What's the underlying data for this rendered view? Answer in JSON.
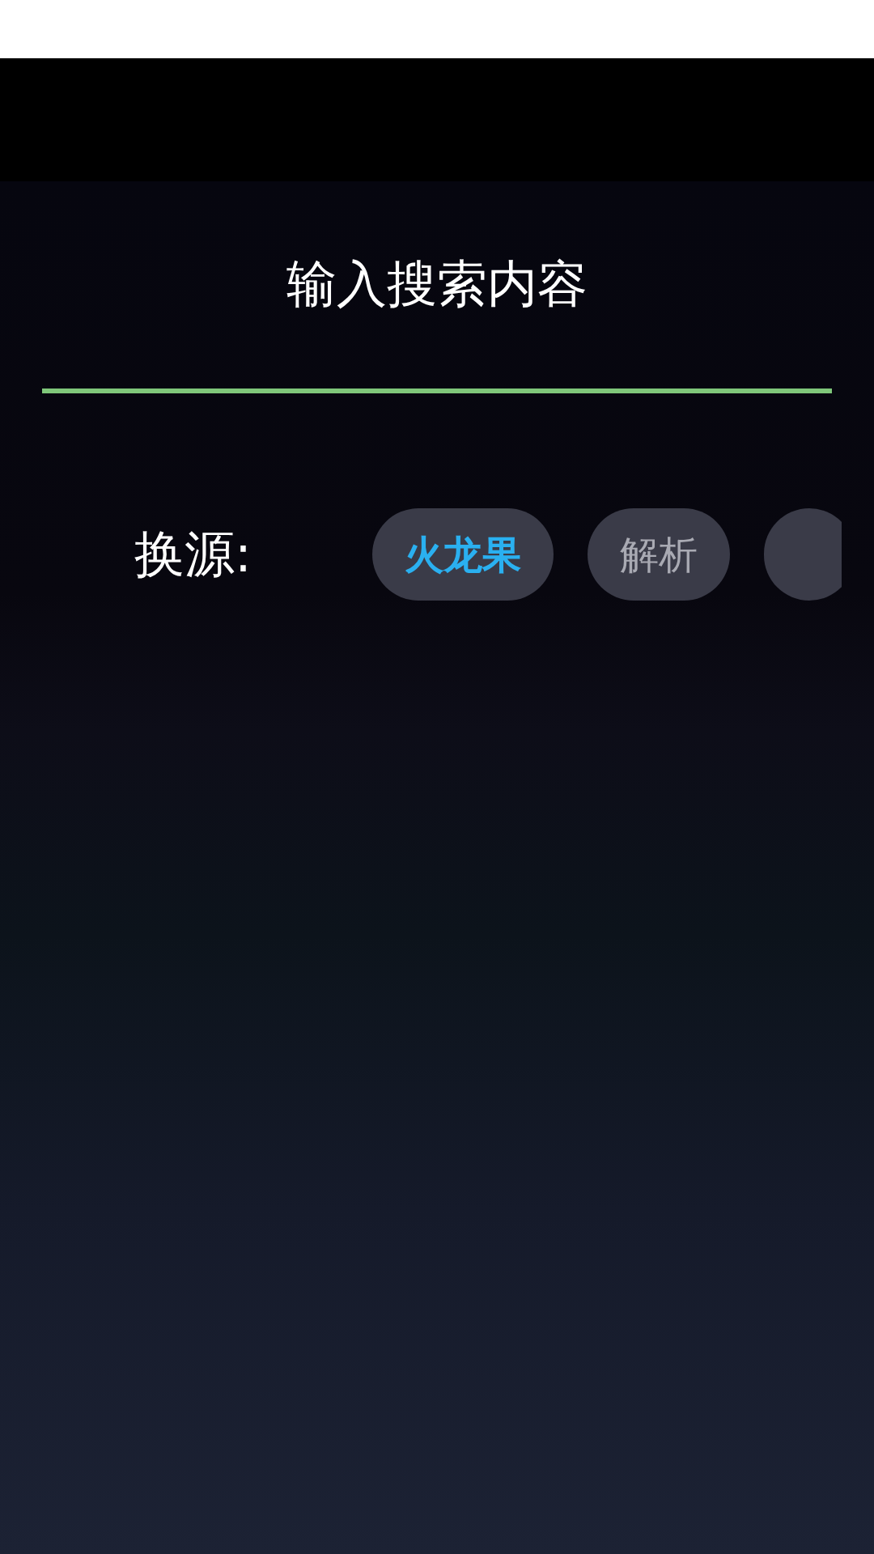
{
  "search": {
    "placeholder": "输入搜索内容"
  },
  "source": {
    "label": "换源:",
    "chips": [
      {
        "kind": "chip",
        "label": "火龙果",
        "selected": true
      },
      {
        "kind": "chip",
        "label": "解析",
        "selected": false
      },
      {
        "kind": "partial"
      }
    ]
  }
}
